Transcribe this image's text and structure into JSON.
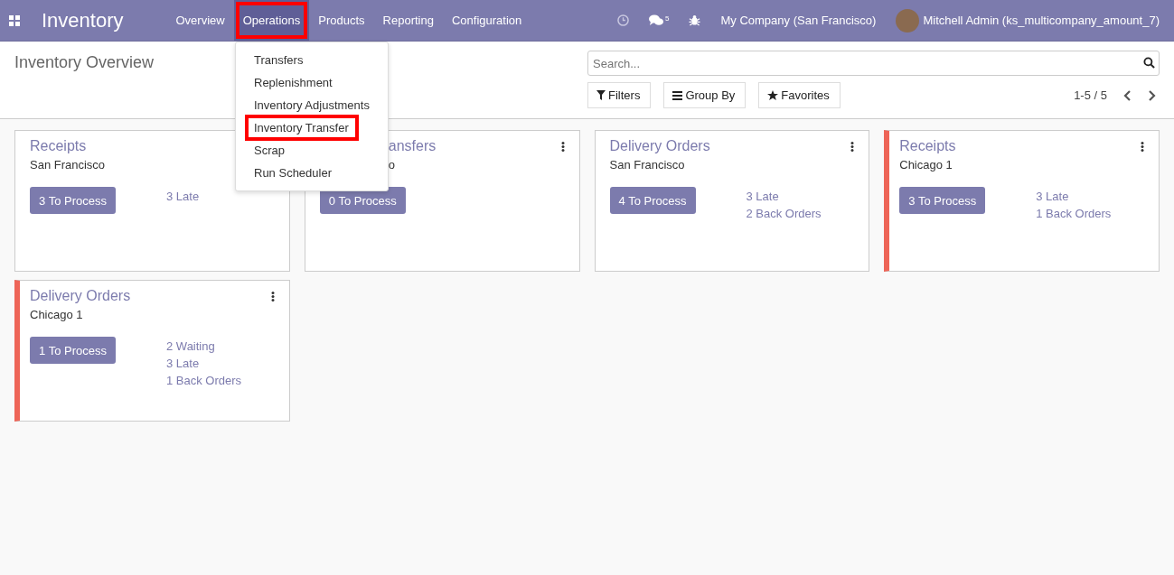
{
  "navbar": {
    "app_name": "Inventory",
    "menus": [
      {
        "label": "Overview",
        "selected": false,
        "highlighted": false
      },
      {
        "label": "Operations",
        "selected": true,
        "highlighted": true
      },
      {
        "label": "Products",
        "selected": false,
        "highlighted": false
      },
      {
        "label": "Reporting",
        "selected": false,
        "highlighted": false
      },
      {
        "label": "Configuration",
        "selected": false,
        "highlighted": false
      }
    ],
    "message_count": "5",
    "company": "My Company (San Francisco)",
    "user": "Mitchell Admin (ks_multicompany_amount_7)"
  },
  "dropdown": {
    "items": [
      {
        "label": "Transfers",
        "highlighted": false
      },
      {
        "label": "Replenishment",
        "highlighted": false
      },
      {
        "label": "Inventory Adjustments",
        "highlighted": false
      },
      {
        "label": "Inventory Transfer",
        "highlighted": true
      },
      {
        "label": "Scrap",
        "highlighted": false
      },
      {
        "label": "Run Scheduler",
        "highlighted": false
      }
    ]
  },
  "control_panel": {
    "title": "Inventory Overview",
    "search": {
      "placeholder": "Search..."
    },
    "buttons": [
      "Filters",
      "Group By",
      "Favorites"
    ],
    "pager": "1-5 / 5"
  },
  "cards": [
    {
      "title": "Receipts",
      "subtitle": "San Francisco",
      "button": "3 To Process",
      "links": [
        "3 Late"
      ],
      "flagged": false,
      "covered": false
    },
    {
      "title": "ansfers",
      "subtitle": "o",
      "button": "0 To Process",
      "flagged": false,
      "covered": true
    },
    {
      "title": "Delivery Orders",
      "subtitle": "San Francisco",
      "button": "4 To Process",
      "links": [
        "3 Late",
        "2 Back Orders"
      ],
      "flagged": false,
      "covered": false
    },
    {
      "title": "Receipts",
      "subtitle": "Chicago 1",
      "button": "3 To Process",
      "links": [
        "3 Late",
        "1 Back Orders"
      ],
      "flagged": true,
      "covered": false
    },
    {
      "title": "Delivery Orders",
      "subtitle": "Chicago 1",
      "button": "1 To Process",
      "links": [
        "2 Waiting",
        "3 Late",
        "1 Back Orders"
      ],
      "flagged": true,
      "covered": false
    }
  ]
}
